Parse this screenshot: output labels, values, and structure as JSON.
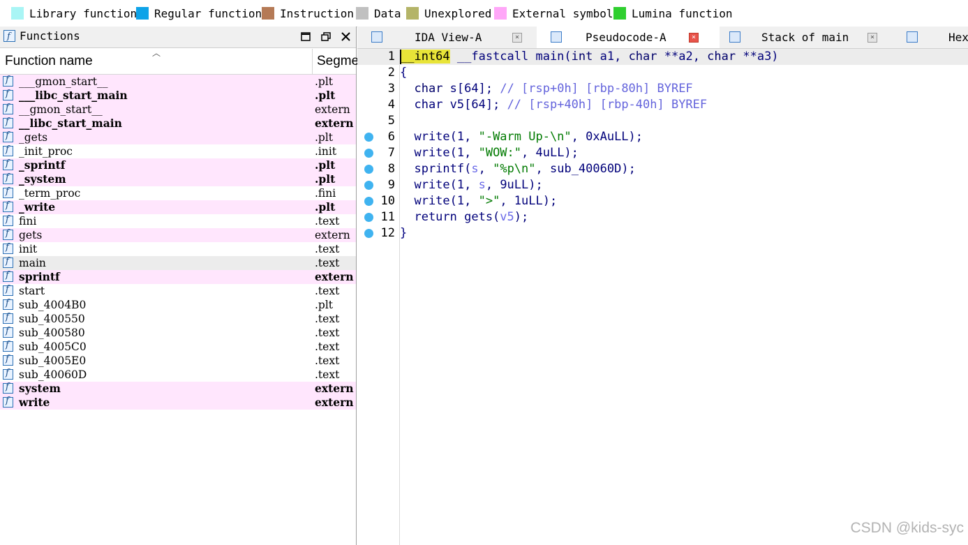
{
  "legend": [
    {
      "label": "Library function",
      "color": "#a9f5f5"
    },
    {
      "label": "Regular function",
      "color": "#0ea3e8"
    },
    {
      "label": "Instruction",
      "color": "#b57a56"
    },
    {
      "label": "Data",
      "color": "#c0c0c0"
    },
    {
      "label": "Unexplored",
      "color": "#b4b468"
    },
    {
      "label": "External symbol",
      "color": "#ffa7f8"
    },
    {
      "label": "Lumina function",
      "color": "#2fcf2f"
    }
  ],
  "functions_pane": {
    "title": "Functions",
    "col_name": "Function name",
    "col_segment": "Segme",
    "rows": [
      {
        "name": "___gmon_start__",
        "segment": ".plt",
        "ext": true,
        "bold": false
      },
      {
        "name": "___libc_start_main",
        "segment": ".plt",
        "ext": true,
        "bold": true
      },
      {
        "name": "__gmon_start__",
        "segment": "extern",
        "ext": true,
        "bold": false
      },
      {
        "name": "__libc_start_main",
        "segment": "extern",
        "ext": true,
        "bold": true
      },
      {
        "name": "_gets",
        "segment": ".plt",
        "ext": true,
        "bold": false
      },
      {
        "name": "_init_proc",
        "segment": ".init",
        "ext": false,
        "bold": false
      },
      {
        "name": "_sprintf",
        "segment": ".plt",
        "ext": true,
        "bold": true
      },
      {
        "name": "_system",
        "segment": ".plt",
        "ext": true,
        "bold": true
      },
      {
        "name": "_term_proc",
        "segment": ".fini",
        "ext": false,
        "bold": false
      },
      {
        "name": "_write",
        "segment": ".plt",
        "ext": true,
        "bold": true
      },
      {
        "name": "fini",
        "segment": ".text",
        "ext": false,
        "bold": false
      },
      {
        "name": "gets",
        "segment": "extern",
        "ext": true,
        "bold": false
      },
      {
        "name": "init",
        "segment": ".text",
        "ext": false,
        "bold": false
      },
      {
        "name": "main",
        "segment": ".text",
        "ext": false,
        "bold": false,
        "selected": true
      },
      {
        "name": "sprintf",
        "segment": "extern",
        "ext": true,
        "bold": true
      },
      {
        "name": "start",
        "segment": ".text",
        "ext": false,
        "bold": false
      },
      {
        "name": "sub_4004B0",
        "segment": ".plt",
        "ext": false,
        "bold": false
      },
      {
        "name": "sub_400550",
        "segment": ".text",
        "ext": false,
        "bold": false
      },
      {
        "name": "sub_400580",
        "segment": ".text",
        "ext": false,
        "bold": false
      },
      {
        "name": "sub_4005C0",
        "segment": ".text",
        "ext": false,
        "bold": false
      },
      {
        "name": "sub_4005E0",
        "segment": ".text",
        "ext": false,
        "bold": false
      },
      {
        "name": "sub_40060D",
        "segment": ".text",
        "ext": false,
        "bold": false
      },
      {
        "name": "system",
        "segment": "extern",
        "ext": true,
        "bold": true
      },
      {
        "name": "write",
        "segment": "extern",
        "ext": true,
        "bold": true
      }
    ]
  },
  "tabs": [
    {
      "label": "IDA View-A",
      "icon": "ida-view-icon",
      "active": false
    },
    {
      "label": "Pseudocode-A",
      "icon": "pseudocode-icon",
      "active": true
    },
    {
      "label": "Stack of main",
      "icon": "stack-icon",
      "active": false
    },
    {
      "label": "Hex",
      "icon": "hex-view-icon",
      "active": false
    }
  ],
  "code": {
    "lines": [
      {
        "num": "1",
        "dot": false,
        "tokens": [
          [
            "__int64",
            "kwhl"
          ],
          [
            " __fastcall main(",
            "g"
          ],
          [
            "int",
            "k"
          ],
          [
            " a1, ",
            "g"
          ],
          [
            "char",
            "k"
          ],
          [
            " **a2, ",
            "g"
          ],
          [
            "char",
            "k"
          ],
          [
            " **a3)",
            "g"
          ]
        ]
      },
      {
        "num": "2",
        "dot": false,
        "tokens": [
          [
            "{",
            "p"
          ]
        ]
      },
      {
        "num": "3",
        "dot": false,
        "tokens": [
          [
            "  ",
            ""
          ],
          [
            "char",
            "k"
          ],
          [
            " s[64]; ",
            "n"
          ],
          [
            "// [rsp+0h] [rbp-80h] BYREF",
            "cm"
          ]
        ]
      },
      {
        "num": "4",
        "dot": false,
        "tokens": [
          [
            "  ",
            ""
          ],
          [
            "char",
            "g"
          ],
          [
            " v5[64]; ",
            "g"
          ],
          [
            "// [rsp+40h] [rbp-40h] BYREF",
            "cm"
          ]
        ]
      },
      {
        "num": "5",
        "dot": false,
        "tokens": []
      },
      {
        "num": "6",
        "dot": true,
        "tokens": [
          [
            "  write(1, ",
            "n"
          ],
          [
            "\"-Warm Up-\\n\"",
            "s"
          ],
          [
            ", 0xAuLL);",
            "n"
          ]
        ]
      },
      {
        "num": "7",
        "dot": true,
        "tokens": [
          [
            "  write(1, ",
            "n"
          ],
          [
            "\"WOW:\"",
            "s"
          ],
          [
            ", 4uLL);",
            "n"
          ]
        ]
      },
      {
        "num": "8",
        "dot": true,
        "tokens": [
          [
            "  sprintf(",
            "n"
          ],
          [
            "s",
            "v"
          ],
          [
            ", ",
            "n"
          ],
          [
            "\"%p\\n\"",
            "s"
          ],
          [
            ", sub_40060D);",
            "n"
          ]
        ]
      },
      {
        "num": "9",
        "dot": true,
        "tokens": [
          [
            "  write(1, ",
            "n"
          ],
          [
            "s",
            "v"
          ],
          [
            ", 9uLL);",
            "n"
          ]
        ]
      },
      {
        "num": "10",
        "dot": true,
        "tokens": [
          [
            "  write(1, ",
            "n"
          ],
          [
            "\">\"",
            "s"
          ],
          [
            ", 1uLL);",
            "n"
          ]
        ]
      },
      {
        "num": "11",
        "dot": true,
        "tokens": [
          [
            "  return gets(",
            "n"
          ],
          [
            "v5",
            "v"
          ],
          [
            ");",
            "n"
          ]
        ]
      },
      {
        "num": "12",
        "dot": true,
        "tokens": [
          [
            "}",
            "p"
          ]
        ]
      }
    ]
  },
  "watermark": "CSDN @kids-syc"
}
